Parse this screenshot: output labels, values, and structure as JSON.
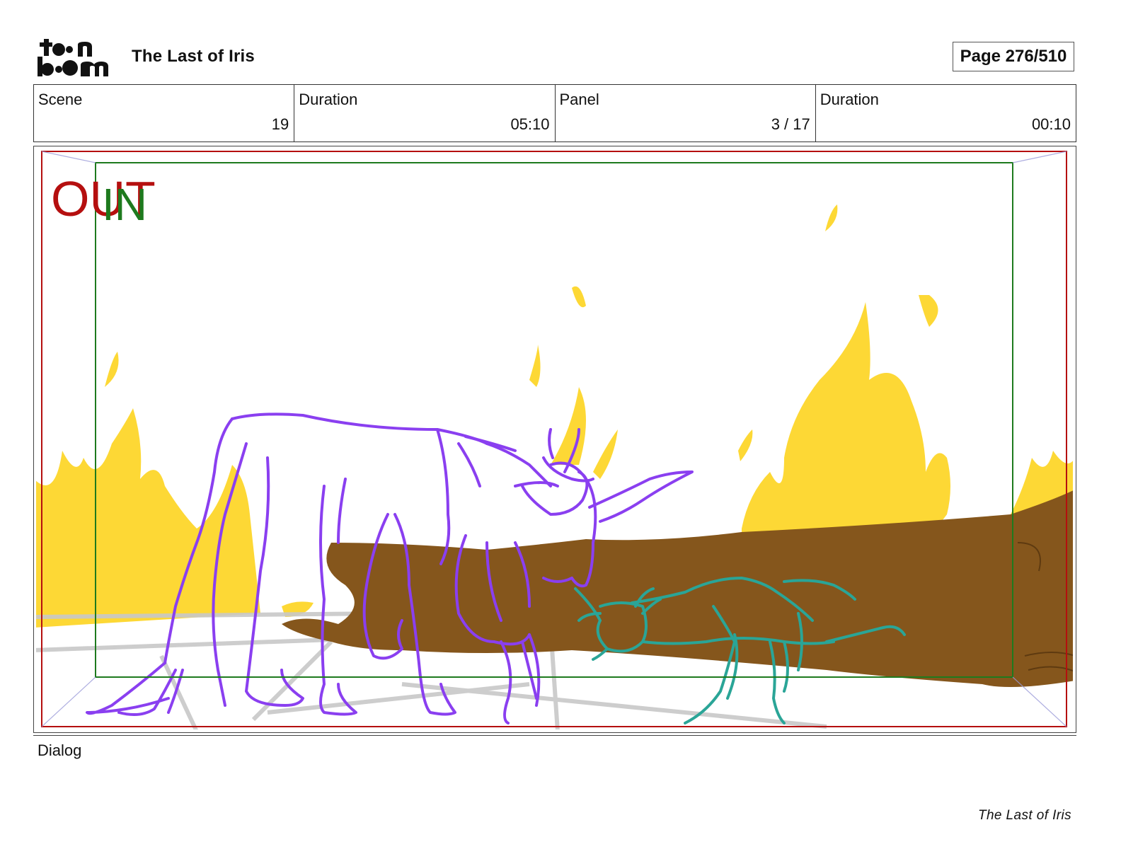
{
  "header": {
    "logo_text": "toon boom",
    "project_title": "The Last of Iris",
    "page_label": "Page 276/510"
  },
  "info": {
    "scene": {
      "label": "Scene",
      "value": "19"
    },
    "scene_duration": {
      "label": "Duration",
      "value": "05:10"
    },
    "panel": {
      "label": "Panel",
      "value": "3 / 17"
    },
    "panel_duration": {
      "label": "Duration",
      "value": "00:10"
    }
  },
  "panel_art": {
    "out_label": "OUT",
    "in_label": "IN",
    "colors": {
      "out_frame": "#b50f0f",
      "in_frame": "#1e7a1e",
      "fire": "#fdd835",
      "log": "#85561c",
      "unicorn": "#8a3ff0",
      "cat": "#2aa597",
      "floor_grid": "#c8c8c8"
    }
  },
  "dialog": {
    "label": "Dialog"
  },
  "footer": {
    "title": "The Last of Iris"
  }
}
